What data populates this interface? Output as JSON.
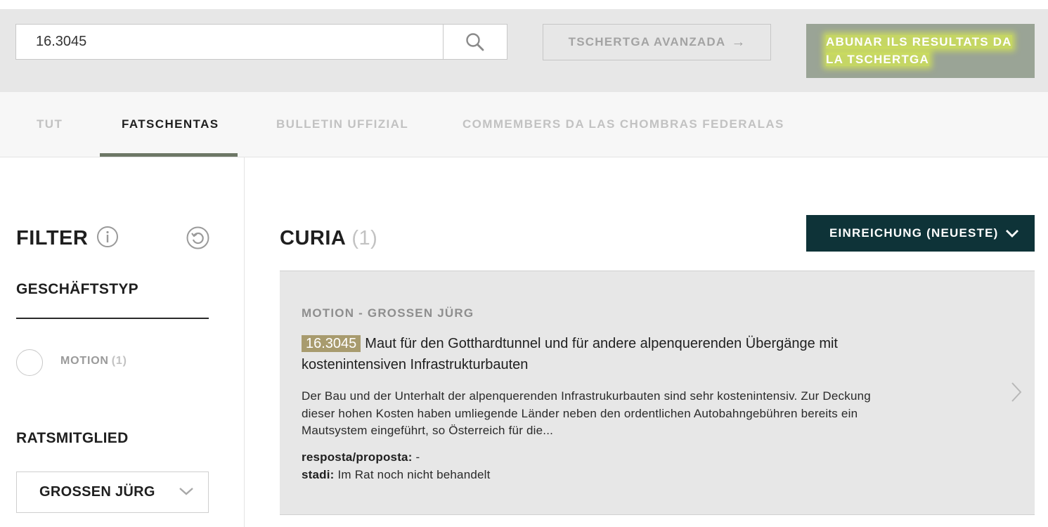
{
  "search": {
    "value": "16.3045",
    "advanced_label": "TSCHERTGA AVANZADA",
    "advanced_arrow": "→",
    "subscribe_line1": "ABUNAR ILS RESULTATS DA",
    "subscribe_line2": "LA TSCHERTGA"
  },
  "tabs": [
    {
      "label": "TUT",
      "active": false
    },
    {
      "label": "FATSCHENTAS",
      "active": true
    },
    {
      "label": "BULLETIN UFFIZIAL",
      "active": false
    },
    {
      "label": "COMMEMBERS DA LAS CHOMBRAS FEDERALAS",
      "active": false
    }
  ],
  "filter": {
    "title": "FILTER",
    "business_type": {
      "title": "GESCHÄFTSTYP",
      "options": [
        {
          "label": "MOTION",
          "count": "(1)",
          "selected": false
        }
      ]
    },
    "council_member": {
      "title": "RATSMITGLIED",
      "selected": "GROSSEN JÜRG"
    }
  },
  "results": {
    "title": "CURIA",
    "count": "(1)",
    "sort_label": "EINREICHUNG (NEUESTE)",
    "items": [
      {
        "meta": "MOTION - GROSSEN JÜRG",
        "number": "16.3045",
        "title": "Maut für den Gotthardtunnel und für andere alpenquerenden Übergänge mit kostenintensiven Infrastrukturbauten",
        "description": "Der Bau und der Unterhalt der alpenquerenden Infrastrukurbauten sind sehr kostenintensiv. Zur Deckung dieser hohen Kosten haben umliegende Länder neben den ordentlichen Autobahngebühren bereits ein Mautsystem eingeführt, so Österreich für die...",
        "answer_label": "resposta/proposta:",
        "answer_value": "-",
        "status_label": "stadi:",
        "status_value": "Im Rat noch nicht behandelt"
      }
    ]
  },
  "colors": {
    "top_bar_bg": "#e7e7e7",
    "tab_bar_bg": "#f7f7f7",
    "tab_underline": "#6d7766",
    "subscribe_bg": "#9aa496",
    "highlight": "#e9ff3c",
    "sort_bg": "#0e3338",
    "number_badge_bg": "#a89b6e",
    "card_bg": "#e7e7e7"
  },
  "icons": {
    "search": "search-icon",
    "info": "info-icon",
    "reset": "reset-icon",
    "chevron_down": "chevron-down-icon",
    "chevron_right": "chevron-right-icon",
    "arrow_right": "arrow-right-icon"
  }
}
